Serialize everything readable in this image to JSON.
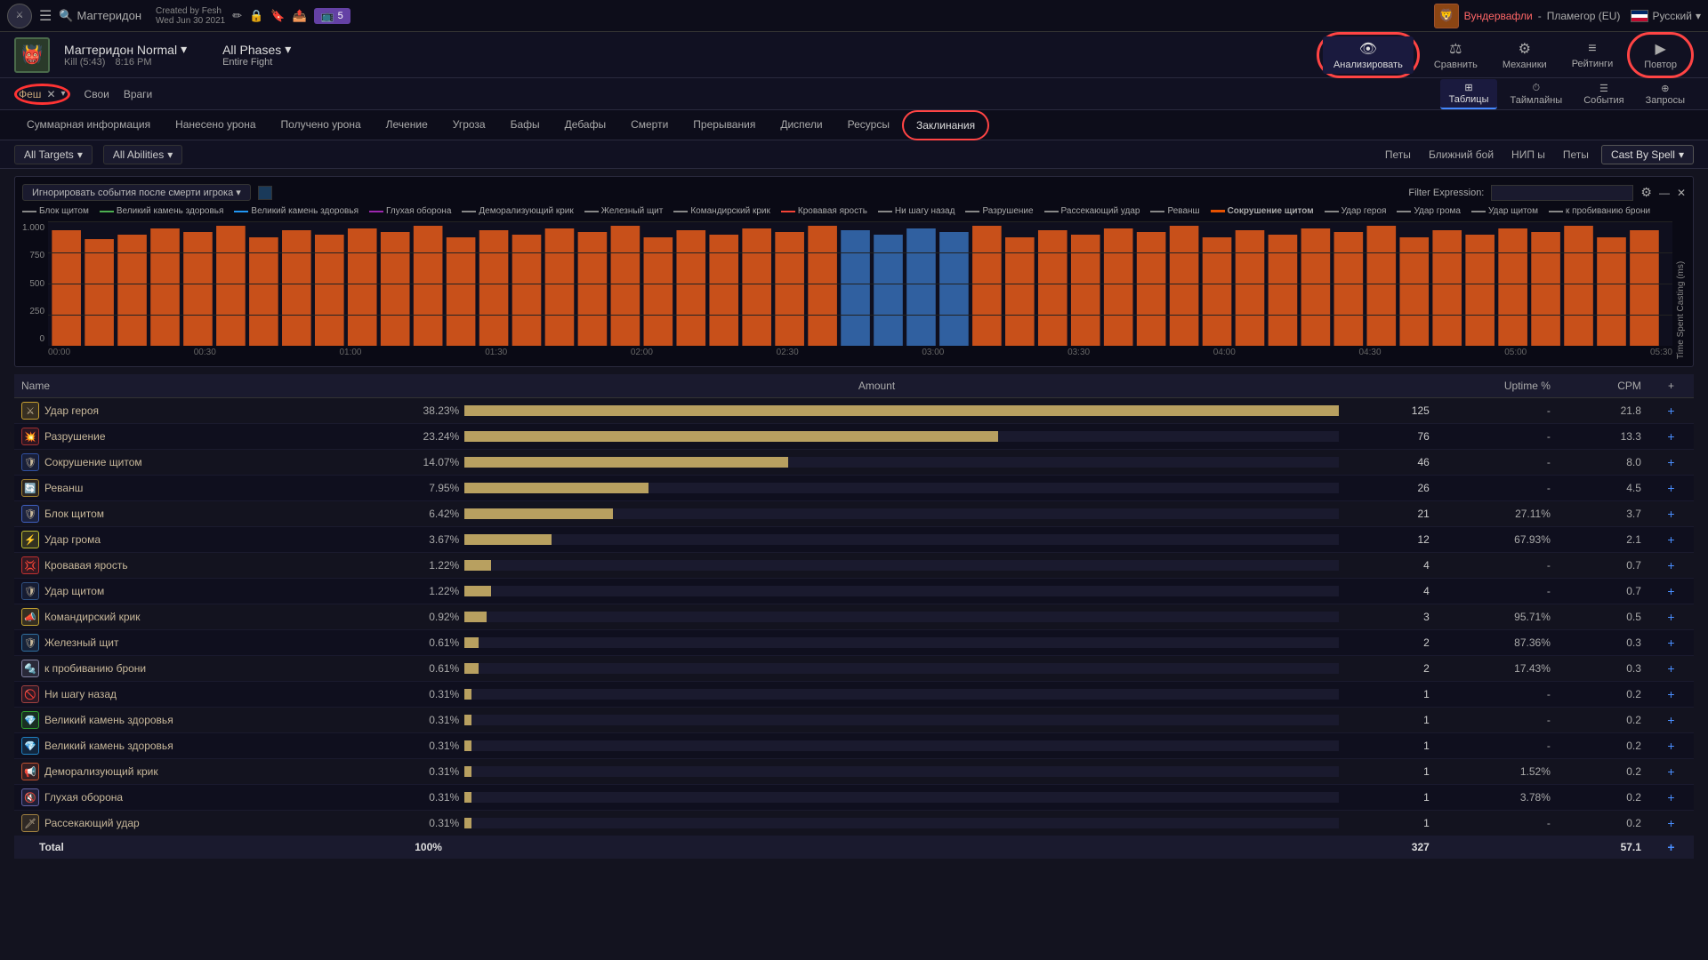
{
  "topnav": {
    "logo_char": "⚔",
    "search_text": "Магтеридон",
    "meta_created": "Created by Fesh",
    "meta_date": "Wed Jun 30 2021",
    "edit_icon": "✏",
    "lock_icon": "🔒",
    "bookmark_icon": "🔖",
    "share_icon": "📤",
    "twitch_label": "5",
    "user_name": "Вундервафли",
    "server": "Пламегор (EU)",
    "language": "Русский"
  },
  "secondnav": {
    "boss_icon": "👹",
    "boss_name": "Магтеридон Normal",
    "boss_kill": "Kill (5:43)",
    "boss_time": "8:16 PM",
    "phases_label": "All Phases",
    "entire_fight": "Entire Fight",
    "tools": [
      {
        "id": "analyze",
        "icon": "👁",
        "label": "Анализировать"
      },
      {
        "id": "compare",
        "icon": "⚖",
        "label": "Сравнить"
      },
      {
        "id": "mechanics",
        "icon": "⚙",
        "label": "Механики"
      },
      {
        "id": "ratings",
        "icon": "≡",
        "label": "Рейтинги"
      },
      {
        "id": "replay",
        "icon": "▶",
        "label": "Повтор"
      }
    ]
  },
  "thirdnav": {
    "player_filter": "Феш",
    "filter_my": "Свои",
    "filter_enemies": "Враги",
    "table_tools": [
      {
        "id": "tables",
        "icon": "⊞",
        "label": "Таблицы"
      },
      {
        "id": "timeline",
        "icon": "⏱",
        "label": "Таймлайны"
      },
      {
        "id": "events",
        "icon": "☰",
        "label": "События"
      },
      {
        "id": "queries",
        "icon": "⊕",
        "label": "Запросы"
      }
    ]
  },
  "tabs": [
    "Суммарная информация",
    "Нанесено урона",
    "Получено урона",
    "Лечение",
    "Угроза",
    "Бафы",
    "Дебафы",
    "Смерти",
    "Прерывания",
    "Диспели",
    "Ресурсы",
    "Заклинания"
  ],
  "filters": {
    "targets_label": "All Targets",
    "abilities_label": "All Abilities",
    "pets_label": "Петы",
    "melee_label": "Ближний бой",
    "npc_label": "НИП ы",
    "pets2_label": "Петы",
    "cast_by_spell": "Cast By Spell"
  },
  "chart": {
    "filter_label": "Игнорировать события после смерти игрока",
    "filter_expr_label": "Filter Expression:",
    "y_label": "Time Spent Casting (ms)",
    "x_ticks": [
      "00:00",
      "00:30",
      "01:00",
      "01:30",
      "02:00",
      "02:30",
      "03:00",
      "03:30",
      "04:00",
      "04:30",
      "05:00",
      "05:30"
    ],
    "y_ticks": [
      "1.000",
      "750",
      "500",
      "250",
      "0"
    ],
    "legend": [
      {
        "color": "#888",
        "label": "Блок щитом"
      },
      {
        "color": "#4CAF50",
        "label": "Великий камень здоровья"
      },
      {
        "color": "#2196F3",
        "label": "Великий камень здоровья"
      },
      {
        "color": "#9C27B0",
        "label": "Глухая оборона"
      },
      {
        "color": "#888",
        "label": "Деморализующий крик"
      },
      {
        "color": "#888",
        "label": "Железный щит"
      },
      {
        "color": "#888",
        "label": "Командирский крик"
      },
      {
        "color": "#f44336",
        "label": "Кровавая ярость"
      },
      {
        "color": "#888",
        "label": "Ни шагу назад"
      },
      {
        "color": "#888",
        "label": "Разрушение"
      },
      {
        "color": "#888",
        "label": "Рассекающий удар"
      },
      {
        "color": "#888",
        "label": "Реванш"
      },
      {
        "color": "#e65100",
        "label": "Сокрушение щитом"
      },
      {
        "color": "#888",
        "label": "Удар героя"
      },
      {
        "color": "#888",
        "label": "Удар грома"
      },
      {
        "color": "#888",
        "label": "Удар щитом"
      },
      {
        "color": "#888",
        "label": "к пробиванию брони"
      }
    ]
  },
  "table": {
    "headers": [
      "Name",
      "Amount",
      "",
      "Uptime %",
      "CPM",
      "+"
    ],
    "rows": [
      {
        "icon": "⚔",
        "icon_color": "#c8a030",
        "name": "Удар героя",
        "pct": "38.23%",
        "bar": 100,
        "count": 125,
        "uptime": "-",
        "cpm": "21.8"
      },
      {
        "icon": "💥",
        "icon_color": "#a03030",
        "name": "Разрушение",
        "pct": "23.24%",
        "bar": 61,
        "count": 76,
        "uptime": "-",
        "cpm": "13.3"
      },
      {
        "icon": "🛡",
        "icon_color": "#3050a0",
        "name": "Сокрушение щитом",
        "pct": "14.07%",
        "bar": 37,
        "count": 46,
        "uptime": "-",
        "cpm": "8.0"
      },
      {
        "icon": "🔄",
        "icon_color": "#a08030",
        "name": "Реванш",
        "pct": "7.95%",
        "bar": 21,
        "count": 26,
        "uptime": "-",
        "cpm": "4.5"
      },
      {
        "icon": "🛡",
        "icon_color": "#4060c0",
        "name": "Блок щитом",
        "pct": "6.42%",
        "bar": 17,
        "count": 21,
        "uptime": "27.11%",
        "cpm": "3.7"
      },
      {
        "icon": "⚡",
        "icon_color": "#c0c030",
        "name": "Удар грома",
        "pct": "3.67%",
        "bar": 10,
        "count": 12,
        "uptime": "67.93%",
        "cpm": "2.1"
      },
      {
        "icon": "💢",
        "icon_color": "#c03030",
        "name": "Кровавая ярость",
        "pct": "1.22%",
        "bar": 3,
        "count": 4,
        "uptime": "-",
        "cpm": "0.7"
      },
      {
        "icon": "🛡",
        "icon_color": "#305080",
        "name": "Удар щитом",
        "pct": "1.22%",
        "bar": 3,
        "count": 4,
        "uptime": "-",
        "cpm": "0.7"
      },
      {
        "icon": "📣",
        "icon_color": "#c0a030",
        "name": "Командирский крик",
        "pct": "0.92%",
        "bar": 2.5,
        "count": 3,
        "uptime": "95.71%",
        "cpm": "0.5"
      },
      {
        "icon": "🛡",
        "icon_color": "#3070a0",
        "name": "Железный щит",
        "pct": "0.61%",
        "bar": 1.6,
        "count": 2,
        "uptime": "87.36%",
        "cpm": "0.3"
      },
      {
        "icon": "🔩",
        "icon_color": "#8080a0",
        "name": "к пробиванию брони",
        "pct": "0.61%",
        "bar": 1.6,
        "count": 2,
        "uptime": "17.43%",
        "cpm": "0.3"
      },
      {
        "icon": "🚫",
        "icon_color": "#a04040",
        "name": "Ни шагу назад",
        "pct": "0.31%",
        "bar": 0.8,
        "count": 1,
        "uptime": "-",
        "cpm": "0.2"
      },
      {
        "icon": "💎",
        "icon_color": "#30a030",
        "name": "Великий камень здоровья",
        "pct": "0.31%",
        "bar": 0.8,
        "count": 1,
        "uptime": "-",
        "cpm": "0.2"
      },
      {
        "icon": "💎",
        "icon_color": "#2080c0",
        "name": "Великий камень здоровья",
        "pct": "0.31%",
        "bar": 0.8,
        "count": 1,
        "uptime": "-",
        "cpm": "0.2"
      },
      {
        "icon": "📢",
        "icon_color": "#c05030",
        "name": "Деморализующий крик",
        "pct": "0.31%",
        "bar": 0.8,
        "count": 1,
        "uptime": "1.52%",
        "cpm": "0.2"
      },
      {
        "icon": "🔇",
        "icon_color": "#6060a0",
        "name": "Глухая оборона",
        "pct": "0.31%",
        "bar": 0.8,
        "count": 1,
        "uptime": "3.78%",
        "cpm": "0.2"
      },
      {
        "icon": "🗡",
        "icon_color": "#a08040",
        "name": "Рассекающий удар",
        "pct": "0.31%",
        "bar": 0.8,
        "count": 1,
        "uptime": "-",
        "cpm": "0.2"
      }
    ],
    "total": {
      "name": "Total",
      "pct": "100%",
      "count": 327,
      "uptime": "",
      "cpm": "57.1"
    }
  }
}
